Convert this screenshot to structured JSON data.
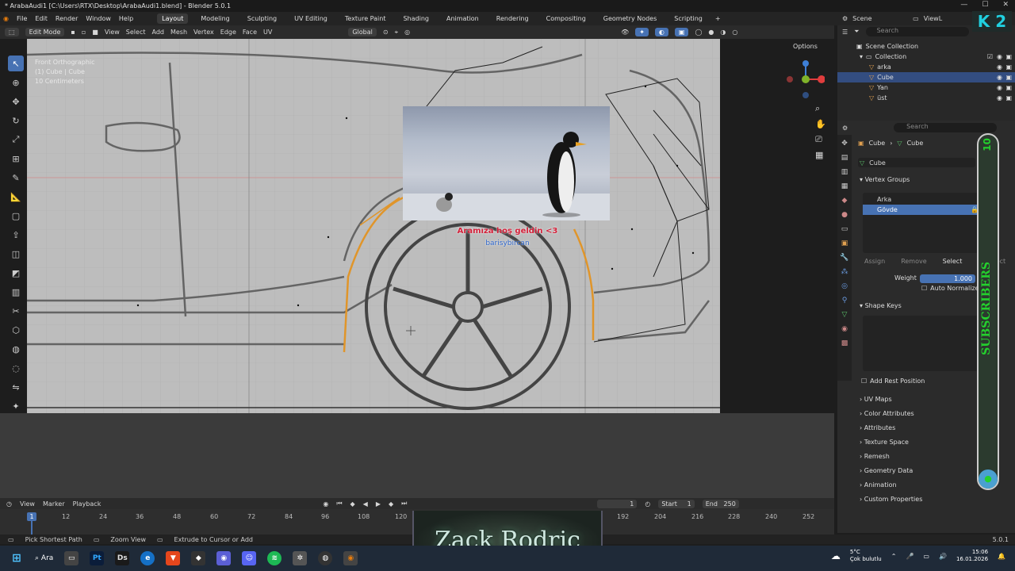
{
  "title": "* ArabaAudi1 [C:\\Users\\RTX\\Desktop\\ArabaAudi1.blend] - Blender 5.0.1",
  "menu": [
    "File",
    "Edit",
    "Render",
    "Window",
    "Help"
  ],
  "workspaces": [
    "Layout",
    "Modeling",
    "Sculpting",
    "UV Editing",
    "Texture Paint",
    "Shading",
    "Animation",
    "Rendering",
    "Compositing",
    "Geometry Nodes",
    "Scripting"
  ],
  "scene": "Scene",
  "view_layer": "ViewL",
  "header": {
    "mode": "Edit Mode",
    "menus": [
      "View",
      "Select",
      "Add",
      "Mesh",
      "Vertex",
      "Edge",
      "Face",
      "UV"
    ],
    "transform": "Global",
    "options": "Options"
  },
  "viewport_info": {
    "line1": "Front Orthographic",
    "line2": "(1) Cube | Cube",
    "line3": "10 Centimeters"
  },
  "overlay": {
    "title": "Aramıza hoş geldin <3",
    "subtitle": "barisybircan"
  },
  "outliner": {
    "search_placeholder": "Search",
    "scene_collection": "Scene Collection",
    "collection": "Collection",
    "items": [
      "arka",
      "Cube",
      "Yan",
      "üst"
    ]
  },
  "properties": {
    "search_placeholder": "Search",
    "breadcrumb": [
      "Cube",
      "Cube"
    ],
    "mesh_name": "Cube",
    "vertex_groups_label": "Vertex Groups",
    "vertex_groups": [
      "Arka",
      "Gövde"
    ],
    "buttons": [
      "Assign",
      "Remove",
      "Select",
      "Deselect"
    ],
    "weight_label": "Weight",
    "weight_value": "1.000",
    "auto_normalize": "Auto Normalize",
    "shape_keys": "Shape Keys",
    "add_rest_position": "Add Rest Position",
    "sections": [
      "UV Maps",
      "Color Attributes",
      "Attributes",
      "Texture Space",
      "Remesh",
      "Geometry Data",
      "Animation",
      "Custom Properties"
    ]
  },
  "timeline": {
    "menus": [
      "View",
      "Marker",
      "Playback"
    ],
    "current_frame": "1",
    "start_label": "Start",
    "start": "1",
    "end_label": "End",
    "end": "250",
    "ticks": [
      "12",
      "24",
      "36",
      "48",
      "60",
      "72",
      "84",
      "96",
      "108",
      "120",
      "192",
      "204",
      "216",
      "228",
      "240",
      "252"
    ],
    "marker": "1"
  },
  "status": {
    "items": [
      "Pick Shortest Path",
      "Zoom View",
      "Extrude to Cursor or Add"
    ],
    "version": "5.0.1"
  },
  "taskbar": {
    "search": "Ara",
    "weather_temp": "5°C",
    "weather_desc": "Çok bulutlu",
    "time": "15:06",
    "date": "16.01.2026"
  },
  "banner": "Zack Rodric",
  "subscribe": {
    "count": "10",
    "text": "SUBSCRIBERS"
  },
  "logo": "K 2"
}
